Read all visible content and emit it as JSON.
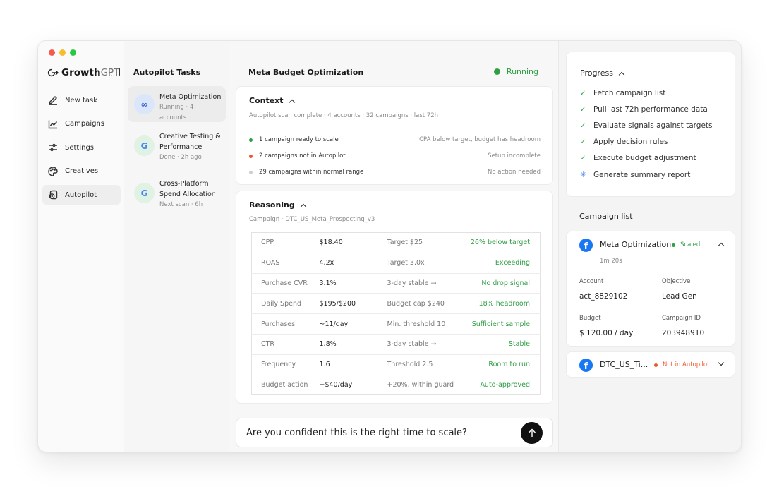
{
  "brand": {
    "name_bold": "Growth",
    "name_light": "GPT"
  },
  "nav": [
    {
      "label": "New task",
      "icon": "pencil-icon"
    },
    {
      "label": "Campaigns",
      "icon": "chart-icon"
    },
    {
      "label": "Settings",
      "icon": "sliders-icon"
    },
    {
      "label": "Creatives",
      "icon": "palette-icon"
    },
    {
      "label": "Autopilot",
      "icon": "autopilot-icon",
      "active": true
    }
  ],
  "tasks": {
    "title": "Autopilot Tasks",
    "items": [
      {
        "name": "Meta Optimization",
        "sub": "Running · 4 accounts",
        "icon": "meta-icon",
        "glyph": "∞"
      },
      {
        "name": "Creative Testing &",
        "name2": "Performance",
        "sub": "Done · 2h ago",
        "icon": "google-icon",
        "glyph": "G"
      },
      {
        "name": "Cross-Platform",
        "name2": "Spend Allocation",
        "sub": "Next scan · 6h",
        "icon": "google-icon",
        "glyph": "G"
      }
    ]
  },
  "main": {
    "title": "Meta Budget Optimization",
    "status": "Running",
    "context": {
      "title": "Context",
      "summary": "Autopilot scan complete · 4 accounts · 32 campaigns · last 72h",
      "rows": [
        {
          "text": "1 campaign ready to scale",
          "note": "CPA below target, budget has headroom",
          "color": "#2f9e44"
        },
        {
          "text": "2 campaigns not in Autopilot",
          "note": "Setup incomplete",
          "color": "#f0552b"
        },
        {
          "text": "29 campaigns within normal range",
          "note": "No action needed",
          "color": "#cfcfcf"
        }
      ]
    },
    "reasoning": {
      "title": "Reasoning",
      "campaign": "Campaign · DTC_US_Meta_Prospecting_v3",
      "rows": [
        {
          "metric": "CPP",
          "value": "$18.40",
          "target": "Target $25",
          "result": "26% below target"
        },
        {
          "metric": "ROAS",
          "value": "4.2x",
          "target": "Target 3.0x",
          "result": "Exceeding"
        },
        {
          "metric": "Purchase CVR",
          "value": "3.1%",
          "target": "3-day stable →",
          "result": "No drop signal"
        },
        {
          "metric": "Daily Spend",
          "value": "$195/$200",
          "target": "Budget cap $240",
          "result": "18% headroom"
        },
        {
          "metric": "Purchases",
          "value": "~11/day",
          "target": "Min. threshold 10",
          "result": "Sufficient sample"
        },
        {
          "metric": "CTR",
          "value": "1.8%",
          "target": "3-day stable →",
          "result": "Stable"
        },
        {
          "metric": "Frequency",
          "value": "1.6",
          "target": "Threshold 2.5",
          "result": "Room to run"
        },
        {
          "metric": "Budget action",
          "value": "+$40/day",
          "target": "+20%, within guard",
          "result": "Auto-approved"
        }
      ]
    },
    "input": {
      "value": "Are you confident this is the right time to scale?"
    }
  },
  "progress": {
    "title": "Progress",
    "steps": [
      {
        "label": "Fetch campaign list",
        "state": "done"
      },
      {
        "label": "Pull last 72h performance data",
        "state": "done"
      },
      {
        "label": "Evaluate signals against targets",
        "state": "done"
      },
      {
        "label": "Apply decision rules",
        "state": "done"
      },
      {
        "label": "Execute budget adjustment",
        "state": "done"
      },
      {
        "label": "Generate summary report",
        "state": "running"
      }
    ]
  },
  "campaign_list": {
    "title": "Campaign list",
    "items": [
      {
        "name": "Meta Optimization",
        "badge": "Scaled",
        "badge_color": "#2f9e44",
        "time": "1m 20s",
        "account_label": "Account",
        "account": "act_8829102",
        "objective_label": "Objective",
        "objective": "Lead Gen",
        "budget_label": "Budget",
        "budget": "$ 120.00 / day",
        "campaign_id_label": "Campaign ID",
        "campaign_id": "203948910"
      },
      {
        "name": "DTC_US_Ti...",
        "badge": "Not in Autopilot",
        "badge_color": "#f0552b"
      }
    ]
  }
}
